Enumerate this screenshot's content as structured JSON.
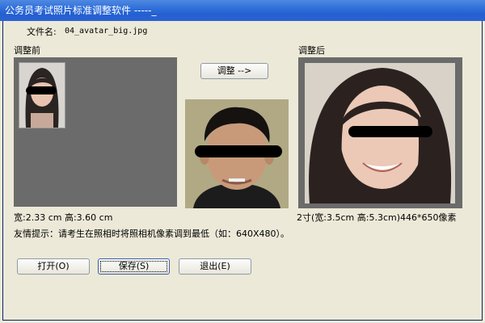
{
  "window": {
    "title": "公务员考试照片标准调整软件 -----_"
  },
  "file": {
    "label": "文件名:",
    "name": "04_avatar_big.jpg"
  },
  "panels": {
    "before_label": "调整前",
    "after_label": "调整后"
  },
  "buttons": {
    "adjust": "调整 -->",
    "open": "打开(O)",
    "save": "保存(S)",
    "exit": "退出(E)"
  },
  "sizes": {
    "before_dims": "宽:2.33 cm 高:3.60 cm",
    "after_dims": "2寸(宽:3.5cm 高:5.3cm)446*650像素"
  },
  "hint": "友情提示：请考生在照相时将照相机像素调到最低（如：640X480）。",
  "colors": {
    "titlebar": "#2a63d4",
    "dialog_bg": "#ece9d8",
    "panel_bg": "#6b6b6b"
  },
  "icons": {
    "photos": [
      "thumbnail-photo-woman",
      "photo-man",
      "photo-woman-adjusted"
    ]
  }
}
